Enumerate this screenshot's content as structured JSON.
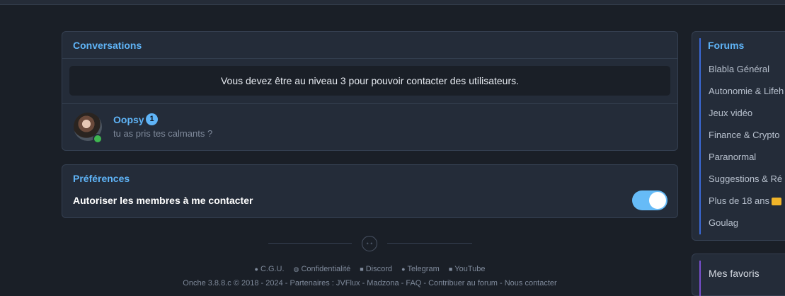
{
  "conversations": {
    "title": "Conversations",
    "notice": "Vous devez être au niveau 3 pour pouvoir contacter des utilisateurs.",
    "items": [
      {
        "name": "Oopsy",
        "unread": "1",
        "preview": "tu as pris tes calmants ?"
      }
    ]
  },
  "preferences": {
    "title": "Préférences",
    "allow_contact_label": "Autoriser les membres à me contacter",
    "allow_contact_enabled": true
  },
  "footer": {
    "links": [
      "C.G.U.",
      "Confidentialité",
      "Discord",
      "Telegram",
      "YouTube"
    ],
    "bottom": "Onche 3.8.8.c © 2018 - 2024 - Partenaires : JVFlux  - Madzona  - FAQ  - Contribuer au forum  - Nous contacter"
  },
  "sidebar": {
    "forums_title": "Forums",
    "forums": [
      "Blabla Général",
      "Autonomie & Lifeh",
      "Jeux vidéo",
      "Finance & Crypto",
      "Paranormal",
      "Suggestions & Ré",
      "Plus de 18 ans",
      "Goulag"
    ],
    "favorites_title": "Mes favoris"
  },
  "colors": {
    "accent": "#5fb4f7",
    "background": "#1a1f27",
    "card": "#242c39",
    "online": "#3fb750"
  }
}
